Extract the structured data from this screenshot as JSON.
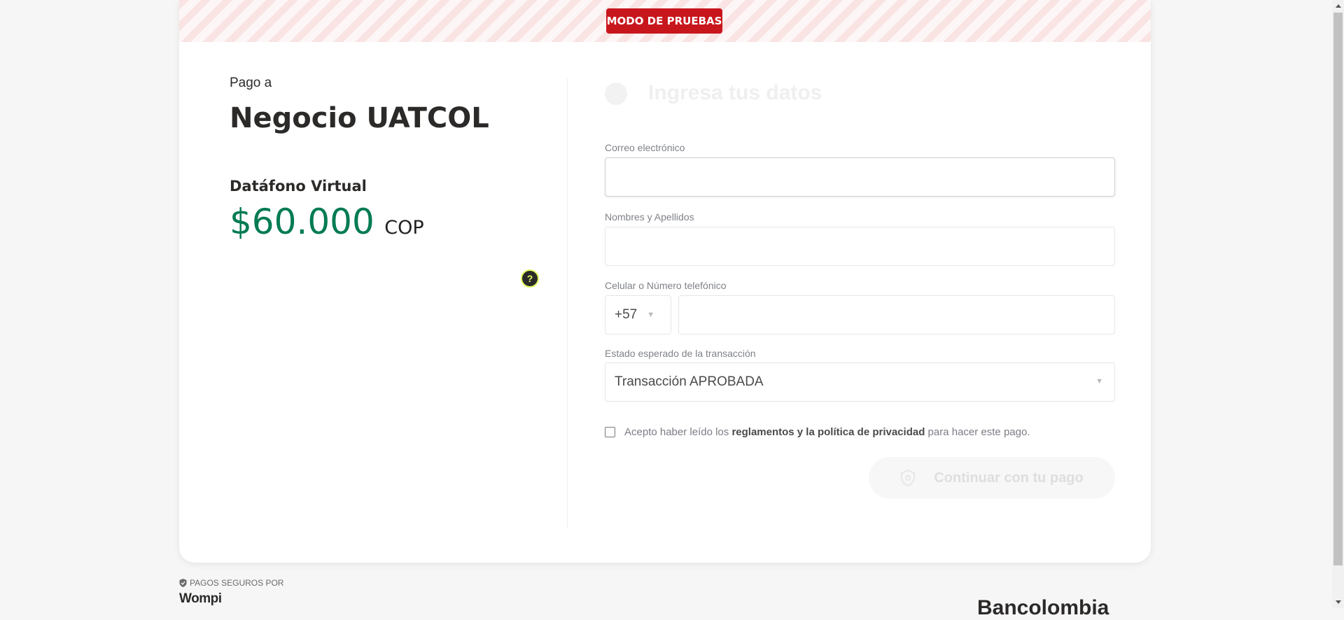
{
  "banner": {
    "mode": "MODO DE PRUEBAS"
  },
  "summary": {
    "pay_to": "Pago a",
    "merchant": "Negocio UATCOL",
    "product": "Datáfono Virtual",
    "amount": "$60.000",
    "currency": "COP",
    "help_icon_text": "?"
  },
  "form": {
    "step_title": "Ingresa tus datos",
    "email_label": "Correo electrónico",
    "email_value": "",
    "name_label": "Nombres y Apellidos",
    "name_value": "",
    "phone_label": "Celular o Número telefónico",
    "country_code": "+57",
    "phone_value": "",
    "status_label": "Estado esperado de la transacción",
    "status_value": "Transacción APROBADA",
    "terms_prefix": "Acepto haber leído los ",
    "terms_link": "reglamentos y la política de privacidad",
    "terms_suffix": " para hacer este pago.",
    "terms_checked": false,
    "continue_button": "Continuar con tu pago"
  },
  "footer": {
    "secure_text": "PAGOS SEGUROS POR",
    "wompi": "Wompi",
    "bancolombia": "Bancolombia"
  },
  "colors": {
    "accent_green": "#007b51",
    "badge_red": "#c8161d",
    "help_yellow": "#dfff61"
  }
}
